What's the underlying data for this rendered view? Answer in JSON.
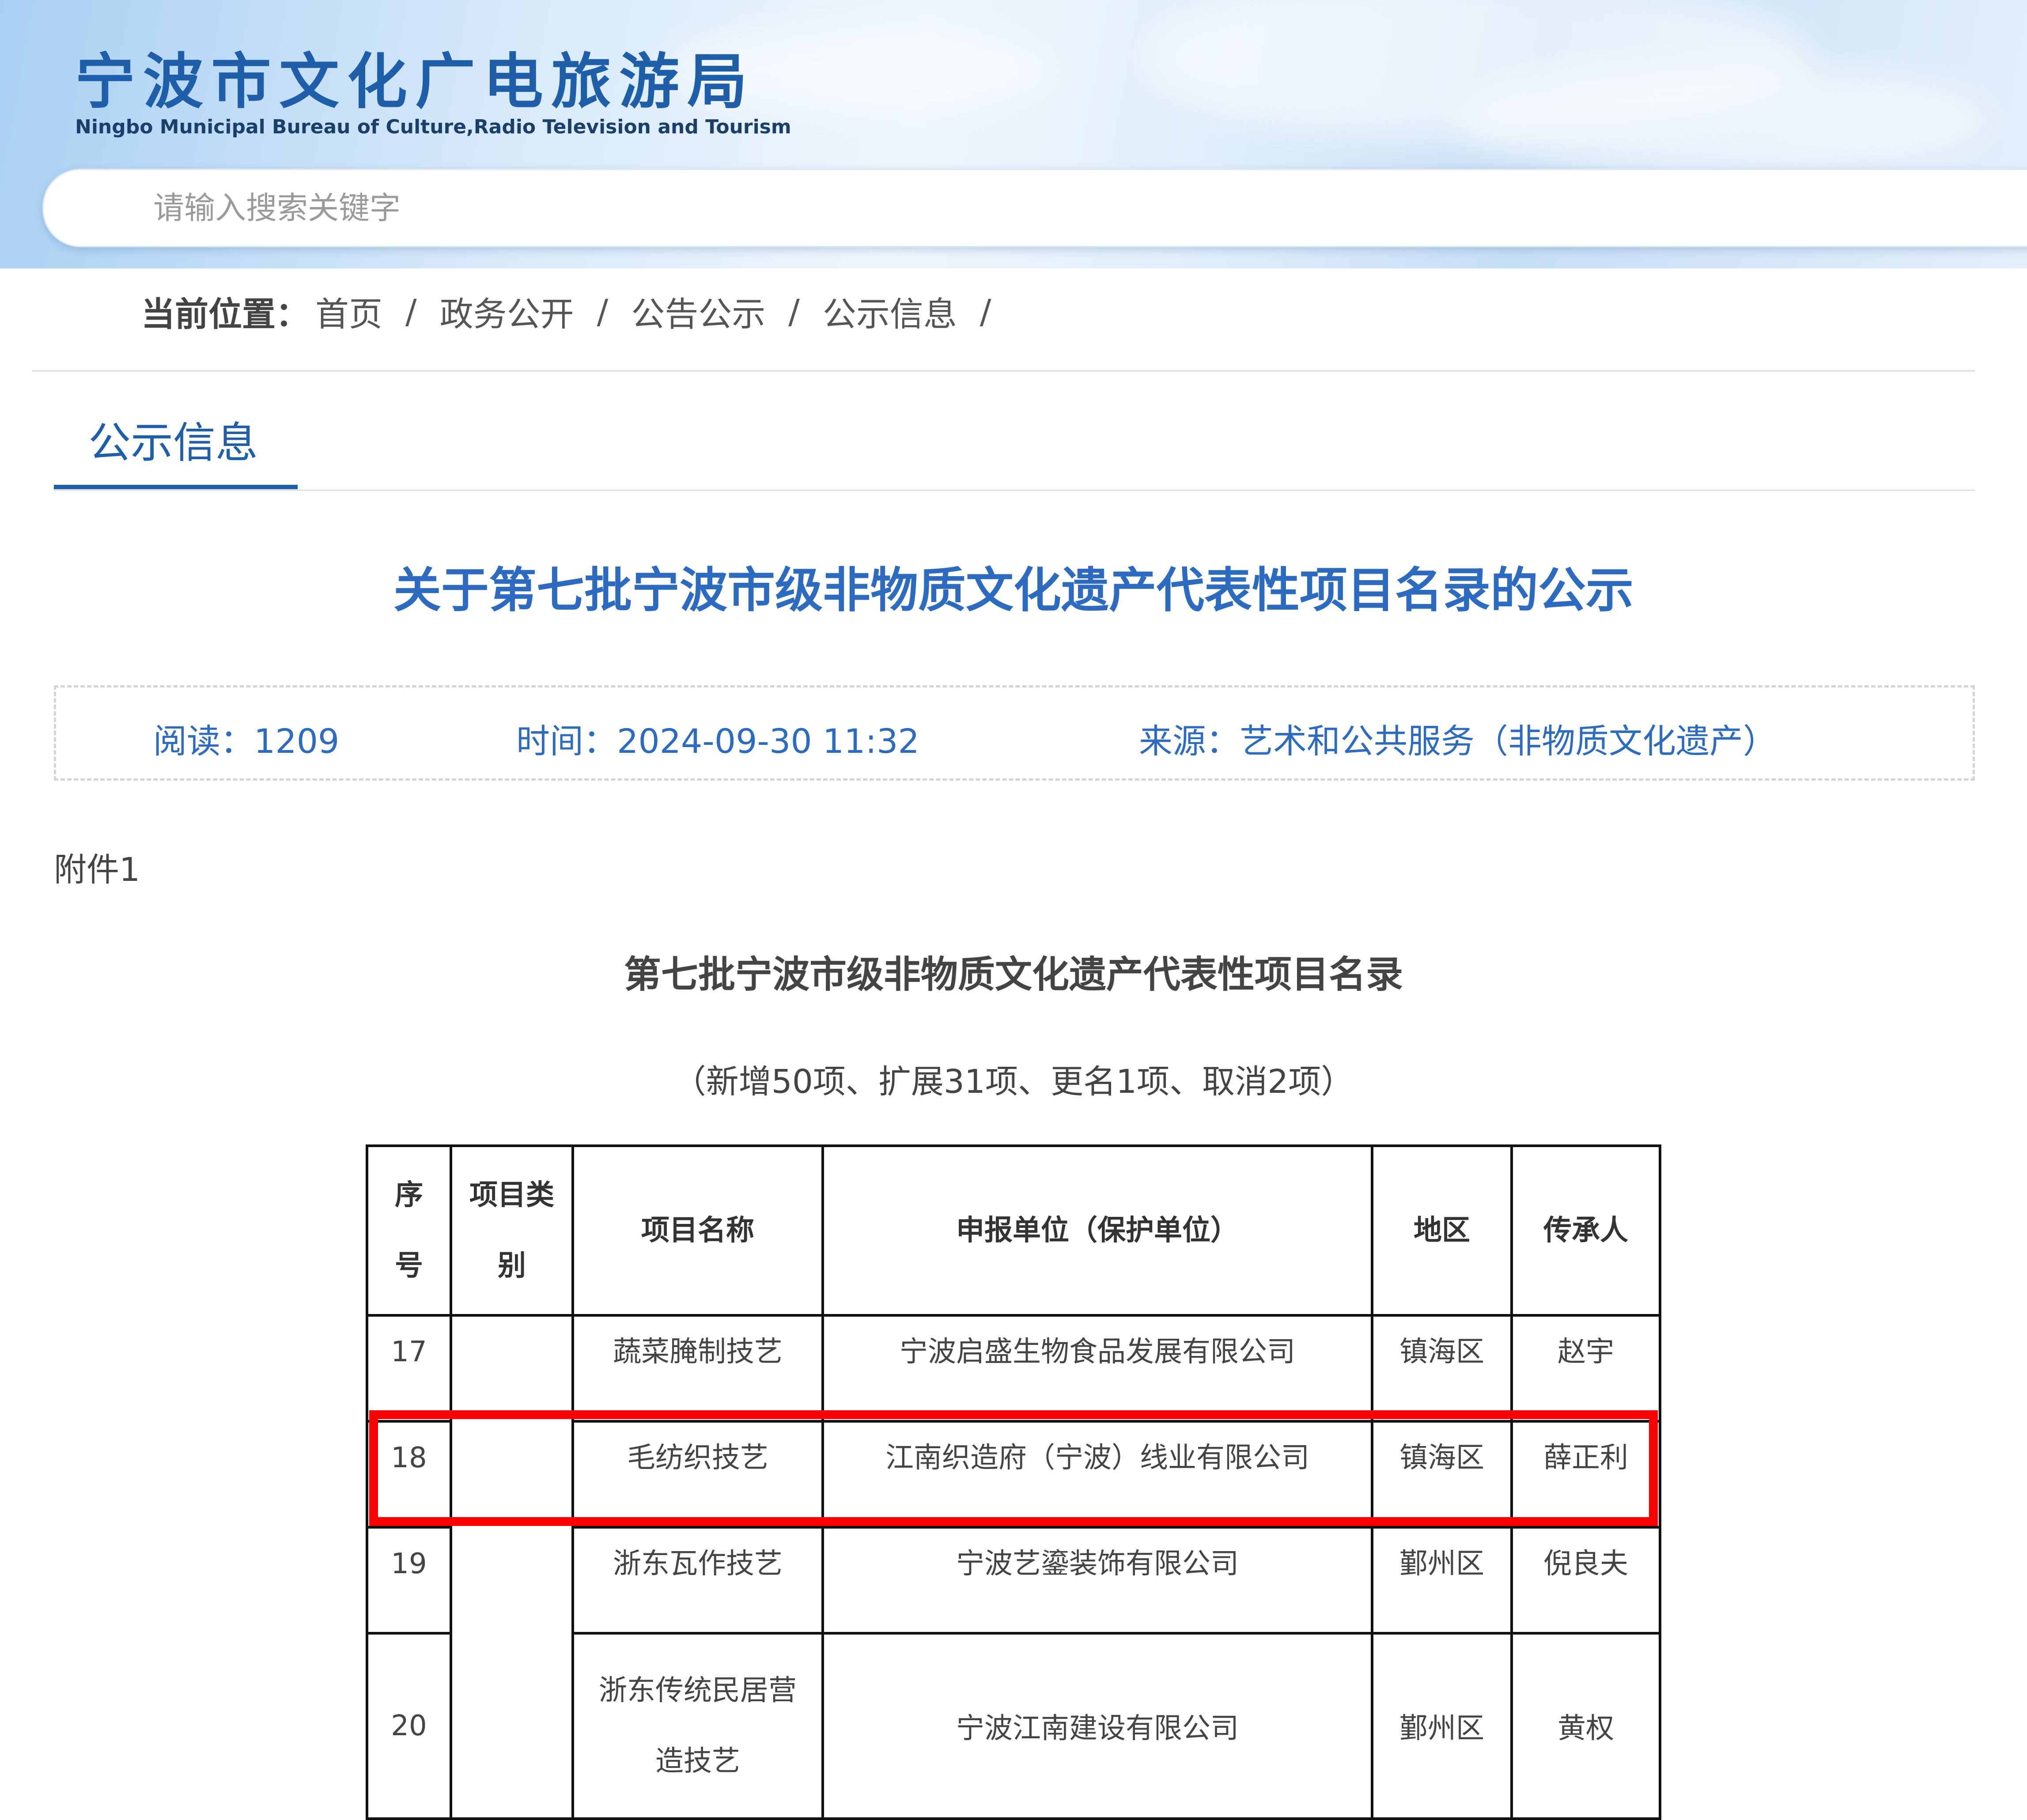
{
  "header": {
    "title": "宁波市文化广电旅游局",
    "subtitle": "Ningbo Municipal Bureau of Culture,Radio Television and Tourism"
  },
  "search": {
    "placeholder": "请输入搜索关键字"
  },
  "breadcrumb": {
    "label": "当前位置：",
    "items": [
      "首页",
      "政务公开",
      "公告公示",
      "公示信息"
    ],
    "separator": "/"
  },
  "tab": {
    "title": "公示信息"
  },
  "article": {
    "title": "关于第七批宁波市级非物质文化遗产代表性项目名录的公示",
    "reads": "阅读：1209",
    "time": "时间：2024-09-30 11:32",
    "source": "来源：艺术和公共服务（非物质文化遗产）",
    "attachment": "附件1",
    "list_title": "第七批宁波市级非物质文化遗产代表性项目名录",
    "list_subtitle": "（新增50项、扩展31项、更名1项、取消2项）"
  },
  "table": {
    "headers": {
      "seq": [
        "序",
        "号"
      ],
      "category": [
        "项目类",
        "别"
      ],
      "name": "项目名称",
      "unit": "申报单位（保护单位）",
      "region": "地区",
      "inheritor": "传承人"
    },
    "rows": [
      {
        "seq": "17",
        "name": "蔬菜腌制技艺",
        "unit": "宁波启盛生物食品发展有限公司",
        "region": "镇海区",
        "inheritor": "赵宇"
      },
      {
        "seq": "18",
        "name": "毛纺织技艺",
        "unit": "江南织造府（宁波）线业有限公司",
        "region": "镇海区",
        "inheritor": "薛正利"
      },
      {
        "seq": "19",
        "name": "浙东瓦作技艺",
        "unit": "宁波艺鎏装饰有限公司",
        "region": "鄞州区",
        "inheritor": "倪良夫"
      },
      {
        "seq": "20",
        "name": [
          "浙东传统民居营",
          "造技艺"
        ],
        "unit": "宁波江南建设有限公司",
        "region": "鄞州区",
        "inheritor": "黄权"
      }
    ]
  },
  "colors": {
    "accent": "#1f5ea8",
    "title_blue": "#2c6bc0",
    "highlight": "#ff0000"
  }
}
